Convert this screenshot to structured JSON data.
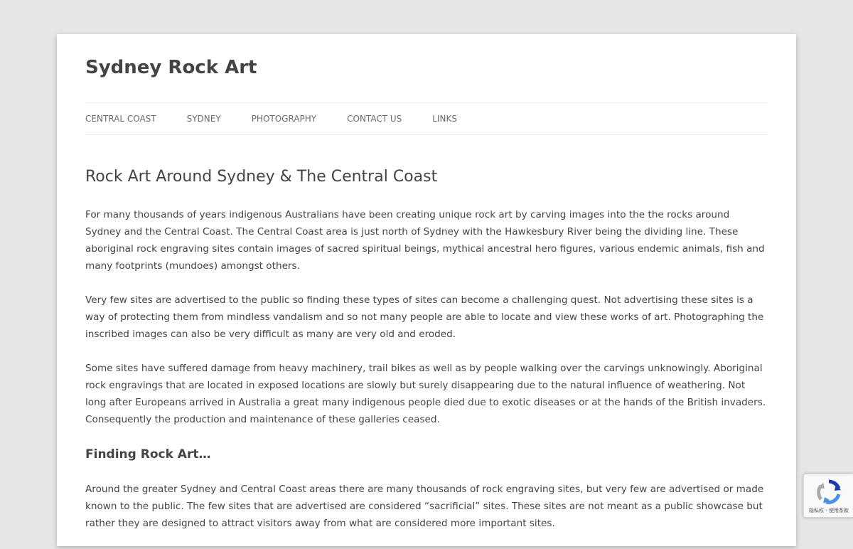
{
  "site": {
    "title": "Sydney Rock Art"
  },
  "nav": {
    "items": [
      {
        "label": "CENTRAL COAST"
      },
      {
        "label": "SYDNEY"
      },
      {
        "label": "PHOTOGRAPHY"
      },
      {
        "label": "CONTACT US"
      },
      {
        "label": "LINKS"
      }
    ]
  },
  "article": {
    "title": "Rock Art Around Sydney & The Central Coast",
    "paragraphs": [
      "For many thousands of years indigenous Australians have been creating unique rock art by carving images into the the rocks around Sydney and the Central Coast. The Central Coast area is just north of Sydney with the Hawkesbury River being the dividing line. These aboriginal rock engraving sites contain images of sacred spiritual beings, mythical ancestral hero figures, various endemic animals, fish and many footprints (mundoes) amongst others.",
      "Very few sites are advertised to the public so finding these types of sites can become a challenging quest. Not advertising these sites is a way of protecting them from mindless vandalism and so not many people are able to locate and view these works of art. Photographing the inscribed images can also be very difficult as many are very old and eroded.",
      "Some sites have suffered damage from heavy machinery, trail bikes as well as by people walking over the carvings unknowingly. Aboriginal rock engravings that are located in exposed locations are slowly but surely disappearing due to the natural influence of weathering. Not long after Europeans arrived in Australia a great many indigenous people died due to exotic diseases or at the hands of the British invaders. Consequently the production and maintenance of these galleries ceased."
    ],
    "subheading": "Finding Rock Art…",
    "paragraph_after": "Around the greater Sydney and Central Coast areas there are many thousands of rock engraving sites, but very few are advertised or made known to the public. The few sites that are advertised are considered “sacrificial” sites. These sites are not meant as a public showcase but rather they are designed to attract visitors away from what are considered more important sites."
  },
  "recaptcha": {
    "footer_text": "隐私权 - 使用条款",
    "icon": "recaptcha-logo-icon"
  },
  "colors": {
    "background": "#e6e6e6",
    "text": "#444444",
    "nav_text": "#6a6a6a"
  }
}
